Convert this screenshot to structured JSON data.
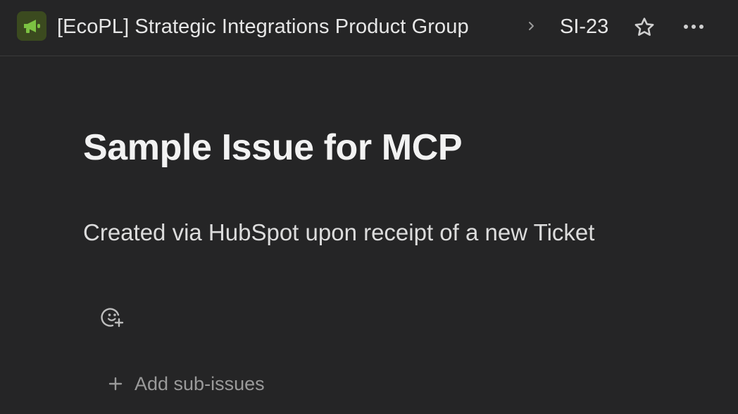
{
  "header": {
    "team_icon": "megaphone-icon",
    "team_icon_bg": "#3b4a1f",
    "team_icon_color": "#7cc242",
    "team_name": "[EcoPL] Strategic Integrations Product Group",
    "separator_icon": "chevron-right-icon",
    "issue_id": "SI-23",
    "star_icon": "star-icon",
    "more_icon": "ellipsis-icon"
  },
  "issue": {
    "title": "Sample Issue for MCP",
    "description": "Created via HubSpot upon receipt of a new Ticket"
  },
  "reactions": {
    "add_reaction_icon": "emoji-add-icon"
  },
  "sub_issues": {
    "add_icon": "plus-icon",
    "add_label": "Add sub-issues"
  },
  "colors": {
    "background": "#252526",
    "text_primary": "#f2f2f2",
    "text_muted": "#9a9a9a",
    "accent_green": "#7cc242"
  }
}
